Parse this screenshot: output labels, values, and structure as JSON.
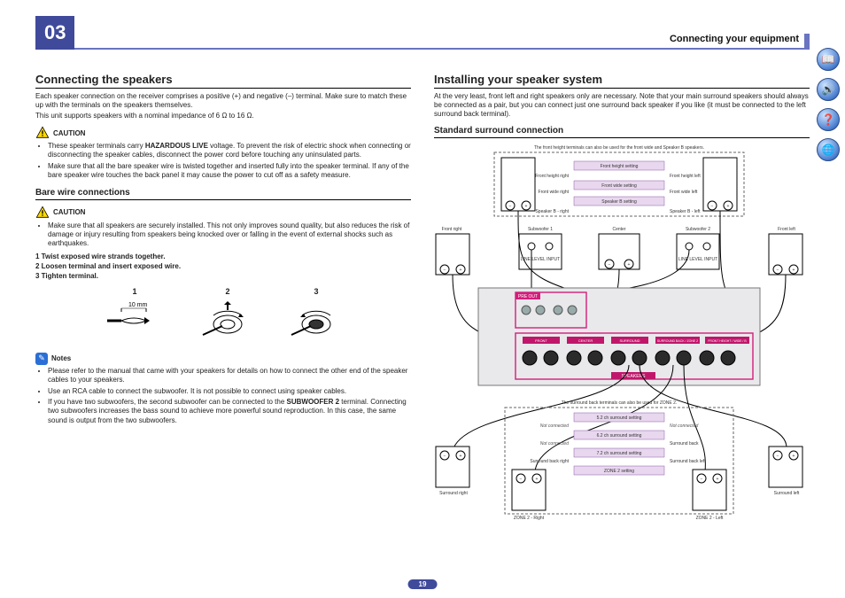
{
  "header": {
    "chapter_number": "03",
    "running_title": "Connecting your equipment",
    "page_number": "19"
  },
  "left": {
    "h2": "Connecting the speakers",
    "intro1": "Each speaker connection on the receiver comprises a positive (+) and negative (–) terminal. Make sure to match these up with the terminals on the speakers themselves.",
    "intro2": "This unit supports speakers with a nominal impedance of 6 Ω to 16 Ω.",
    "caution_label": "CAUTION",
    "caution1_b1_a": "These speaker terminals carry ",
    "caution1_b1_bold": "HAZARDOUS LIVE",
    "caution1_b1_b": " voltage. To prevent the risk of electric shock when connecting or disconnecting the speaker cables, disconnect the power cord before touching any uninsulated parts.",
    "caution1_b2": "Make sure that all the bare speaker wire is twisted together and inserted fully into the speaker terminal. If any of the bare speaker wire touches the back panel it may cause the power to cut off as a safety measure.",
    "h3_bare": "Bare wire connections",
    "caution2_b1": "Make sure that all speakers are securely installed. This not only improves sound quality, but also reduces the risk of damage or injury resulting from speakers being knocked over or falling in the event of external shocks such as earthquakes.",
    "step1": "1   Twist exposed wire strands together.",
    "step2": "2   Loosen terminal and insert exposed wire.",
    "step3": "3   Tighten terminal.",
    "fig1_num": "1",
    "fig2_num": "2",
    "fig3_num": "3",
    "fig1_label": "10 mm",
    "notes_label": "Notes",
    "note_b1": "Please refer to the manual that came with your speakers for details on how to connect the other end of the speaker cables to your speakers.",
    "note_b2": "Use an RCA cable to connect the subwoofer. It is not possible to connect using speaker cables.",
    "note_b3_a": "If you have two subwoofers, the second subwoofer can be connected to the ",
    "note_b3_bold": "SUBWOOFER 2",
    "note_b3_b": " terminal. Connecting two subwoofers increases the bass sound to achieve more powerful sound reproduction. In this case, the same sound is output from the two subwoofers."
  },
  "right": {
    "h2": "Installing your speaker system",
    "intro": "At the very least, front left and right speakers only are necessary. Note that your main surround speakers should always be connected as a pair, but you can connect just one surround back speaker if you like (it must be connected to the left surround back terminal).",
    "h3_standard": "Standard surround connection",
    "top_caption": "The front height terminals can also be used for the front wide and Speaker B speakers.",
    "bot_caption": "The surround back terminals can also be used for ZONE 2.",
    "labels": {
      "front_right": "Front right",
      "front_left": "Front left",
      "subwoofer1": "Subwoofer 1",
      "subwoofer2": "Subwoofer 2",
      "center": "Center",
      "surround_right": "Surround right",
      "surround_left": "Surround left",
      "front_height_right": "Front height right",
      "front_height_left": "Front height left",
      "front_wide_right": "Front wide right",
      "front_wide_left": "Front wide left",
      "speaker_b_right": "Speaker B - right",
      "speaker_b_left": "Speaker B - left",
      "surround_back_right": "Surround back right",
      "surround_back_left": "Surround back left",
      "zone2_right": "ZONE 2 - Right",
      "zone2_left": "ZONE 2 - Left",
      "not_connected": "Not connected",
      "surround_back": "Surround back",
      "line_level_input": "LINE LEVEL INPUT",
      "pre_out": "PRE OUT",
      "speakers_panel": "SPEAKERS",
      "front_panel": "FRONT",
      "center_panel": "CENTER",
      "surround_panel": "SURROUND",
      "sb_zone_panel": "SURROUND BACK / ZONE 2",
      "fh_fw_b_panel": "FRONT HEIGHT / WIDE / B",
      "front_height_setting": "Front height setting",
      "front_wide_setting": "Front wide setting",
      "speaker_b_setting": "Speaker B setting",
      "s52": "5.2 ch surround setting",
      "s62": "6.2 ch surround setting",
      "s72": "7.2 ch surround setting",
      "zone2_setting": "ZONE 2 setting"
    }
  },
  "side_icons": [
    "book-icon",
    "speaker-icon",
    "help-icon",
    "globe-icon"
  ]
}
